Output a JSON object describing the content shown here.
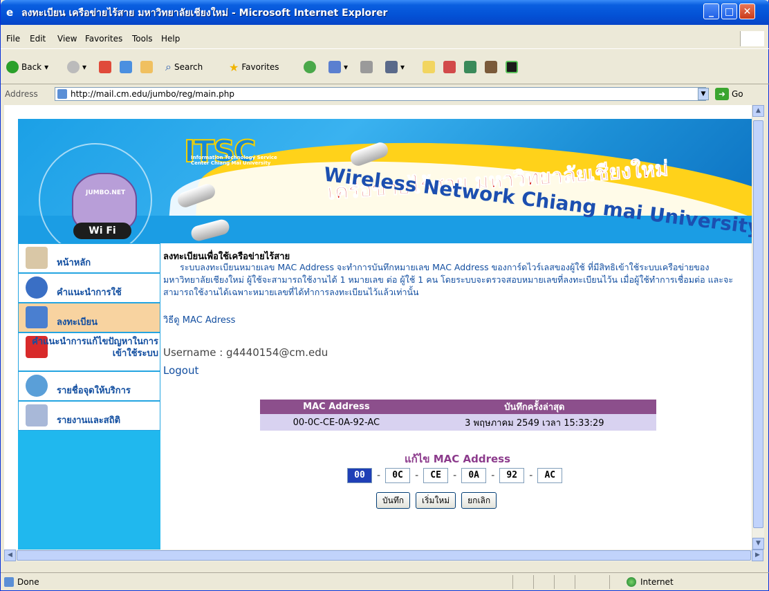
{
  "window": {
    "title": "ลงทะเบียน เครือข่ายไร้สาย มหาวิทยาลัยเชียงใหม่ - Microsoft Internet Explorer",
    "min_symbol": "_",
    "max_symbol": "□",
    "close_symbol": "✕"
  },
  "menu": [
    "File",
    "Edit",
    "View",
    "Favorites",
    "Tools",
    "Help"
  ],
  "toolbar": {
    "back": "Back",
    "search": "Search",
    "favorites": "Favorites"
  },
  "address": {
    "label": "Address",
    "url": "http://mail.cm.edu/jumbo/reg/main.php",
    "go": "Go"
  },
  "banner": {
    "logo_text": "ITSC",
    "logo_sub": "Information Technology Service Center Chiang Mai University",
    "elephant_text": "JUMBO.NET",
    "wifi": "Wi Fi",
    "thai_title": "เครือข่ายไร้สาย มหาวิทยาลัยเชียงใหม่",
    "eng_title": "Wireless Network Chiang mai University"
  },
  "sidebar": {
    "items": [
      {
        "label": "หน้าหลัก",
        "icon": "home-icon"
      },
      {
        "label": "คำแนะนำการใช้",
        "icon": "help-icon"
      },
      {
        "label": "ลงทะเบียน",
        "icon": "register-icon"
      },
      {
        "label": "คำแนะนำการแก้ไขปัญหาในการเข้าใช้ระบบ",
        "icon": "error-icon"
      },
      {
        "label": "รายชื่อจุดให้บริการ",
        "icon": "globe-icon"
      },
      {
        "label": "รายงานและสถิติ",
        "icon": "report-icon"
      }
    ]
  },
  "content": {
    "heading": "ลงทะเบียนเพื่อใช้เครือข่ายไร้สาย",
    "paragraph": "ระบบลงทะเบียนหมายเลข MAC Address จะทำการบันทึกหมายเลข MAC Address ของการ์ดไวร์เลสของผู้ใช้ ที่มีสิทธิเข้าใช้ระบบเครือข่ายของมหาวิทยาลัยเชียงใหม่ ผู้ใช้จะสามารถใช้งานได้ 1 หมายเลข ต่อ ผู้ใช้ 1 คน โดยระบบจะตรวจสอบหมายเลขที่ลงทะเบียนไว้น เมื่อผู้ใช้ทำการเชื่อมต่อ และจะสามารถใช้งานได้เฉพาะหมายเลขที่ได้ทำการลงทะเบียนไว้แล้วเท่านั้น",
    "mac_link": "วิธีดู MAC Adress",
    "username": "Username : g4440154@cm.edu",
    "logout": "Logout",
    "table_headers": [
      "MAC Address",
      "บันทึกครั้งล่าสุด"
    ],
    "table_rows": [
      [
        "00-0C-CE-0A-92-AC",
        "3 พฤษภาคม 2549 เวลา 15:33:29"
      ]
    ],
    "edit_title": "แก้ไข MAC Address",
    "mac_fields": [
      "00",
      "0C",
      "CE",
      "0A",
      "92",
      "AC"
    ],
    "dash": "-",
    "buttons": {
      "save": "บันทึก",
      "reset": "เริ่มใหม่",
      "cancel": "ยกเลิก"
    }
  },
  "status": {
    "text": "Done",
    "zone": "Internet"
  }
}
